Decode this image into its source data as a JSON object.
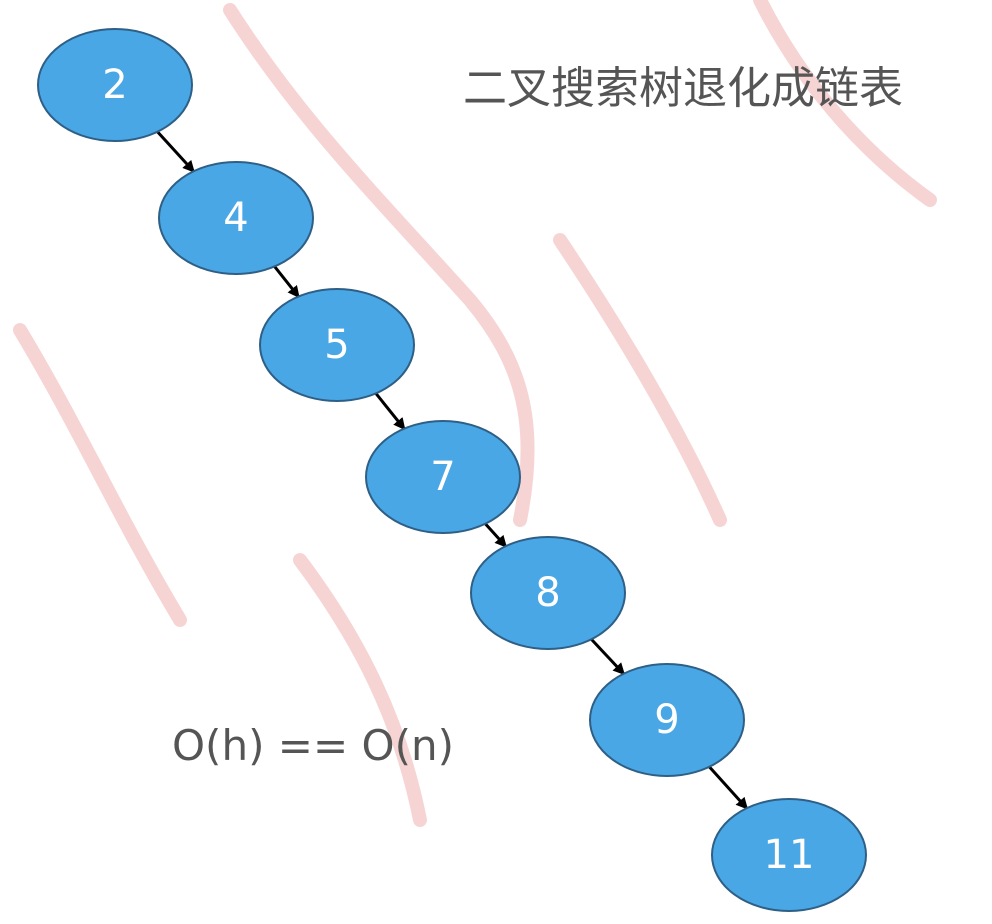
{
  "title": "二叉搜索树退化成链表",
  "formula": "O(h) == O(n)",
  "colors": {
    "node_fill": "#4aa7e6",
    "node_stroke": "#2e5f86",
    "edge": "#000000",
    "text_gray": "#555555",
    "watermark": "#f7d4d4"
  },
  "nodes": [
    {
      "id": "n2",
      "label": "2"
    },
    {
      "id": "n4",
      "label": "4"
    },
    {
      "id": "n5",
      "label": "5"
    },
    {
      "id": "n7",
      "label": "7"
    },
    {
      "id": "n8",
      "label": "8"
    },
    {
      "id": "n9",
      "label": "9"
    },
    {
      "id": "n11",
      "label": "11"
    }
  ],
  "edges": [
    {
      "from": "n2",
      "to": "n4"
    },
    {
      "from": "n4",
      "to": "n5"
    },
    {
      "from": "n5",
      "to": "n7"
    },
    {
      "from": "n7",
      "to": "n8"
    },
    {
      "from": "n8",
      "to": "n9"
    },
    {
      "from": "n9",
      "to": "n11"
    }
  ]
}
